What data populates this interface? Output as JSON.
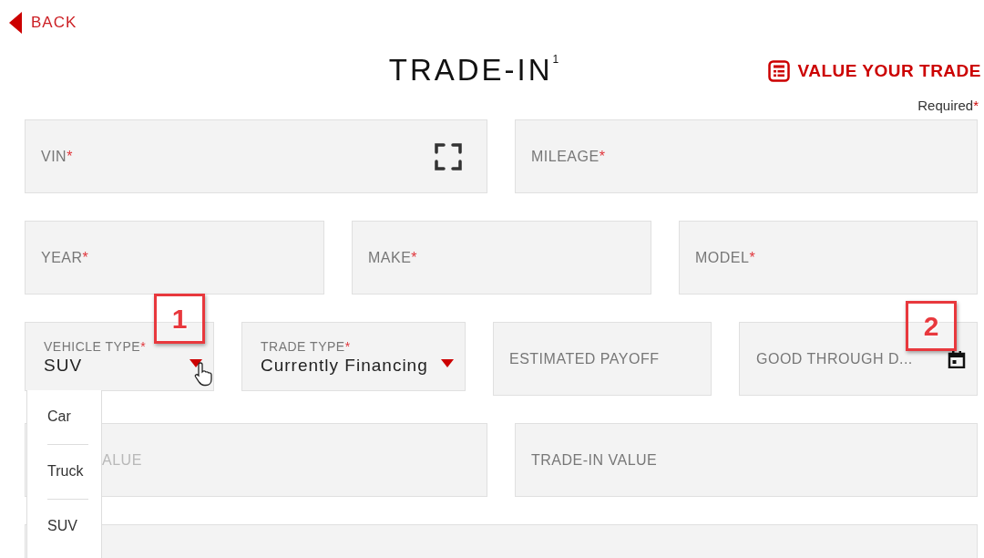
{
  "back_link": {
    "label": "BACK"
  },
  "title": {
    "text": "TRADE-IN",
    "footnote": "1"
  },
  "value_your_trade": {
    "label": "VALUE YOUR TRADE"
  },
  "required_legend": {
    "text": "Required",
    "mark": "*"
  },
  "rows": [
    {
      "fields": [
        {
          "kind": "vin",
          "label": "VIN",
          "required_mark": "*"
        },
        {
          "kind": "input",
          "label": "MILEAGE",
          "required_mark": "*"
        }
      ]
    },
    {
      "fields": [
        {
          "kind": "input",
          "label": "YEAR",
          "required_mark": "*"
        },
        {
          "kind": "input",
          "label": "MAKE",
          "required_mark": "*"
        },
        {
          "kind": "input",
          "label": "MODEL",
          "required_mark": "*"
        }
      ]
    },
    {
      "fields": [
        {
          "kind": "select",
          "label": "VEHICLE TYPE",
          "required_mark": "*",
          "value": "SUV",
          "expanded": true,
          "options": [
            "Car",
            "Truck",
            "SUV"
          ]
        },
        {
          "kind": "select",
          "label": "TRADE TYPE",
          "required_mark": "*",
          "value": "Currently Financing",
          "expanded": false
        },
        {
          "kind": "input",
          "label": "ESTIMATED PAYOFF"
        },
        {
          "kind": "date",
          "label": "GOOD THROUGH D..."
        }
      ]
    },
    {
      "fields": [
        {
          "kind": "input",
          "label": "ALUE",
          "disabled": true
        },
        {
          "kind": "input",
          "label": "TRADE-IN VALUE"
        }
      ]
    },
    {
      "fields": [
        {
          "kind": "input"
        }
      ]
    }
  ],
  "annotations": [
    {
      "number": "1"
    },
    {
      "number": "2"
    }
  ]
}
